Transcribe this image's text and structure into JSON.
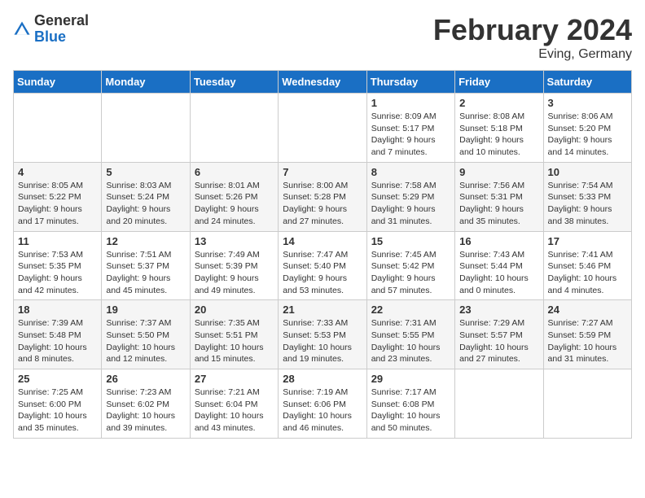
{
  "logo": {
    "general": "General",
    "blue": "Blue"
  },
  "title": "February 2024",
  "subtitle": "Eving, Germany",
  "headers": [
    "Sunday",
    "Monday",
    "Tuesday",
    "Wednesday",
    "Thursday",
    "Friday",
    "Saturday"
  ],
  "weeks": [
    [
      {
        "day": "",
        "info": ""
      },
      {
        "day": "",
        "info": ""
      },
      {
        "day": "",
        "info": ""
      },
      {
        "day": "",
        "info": ""
      },
      {
        "day": "1",
        "info": "Sunrise: 8:09 AM\nSunset: 5:17 PM\nDaylight: 9 hours\nand 7 minutes."
      },
      {
        "day": "2",
        "info": "Sunrise: 8:08 AM\nSunset: 5:18 PM\nDaylight: 9 hours\nand 10 minutes."
      },
      {
        "day": "3",
        "info": "Sunrise: 8:06 AM\nSunset: 5:20 PM\nDaylight: 9 hours\nand 14 minutes."
      }
    ],
    [
      {
        "day": "4",
        "info": "Sunrise: 8:05 AM\nSunset: 5:22 PM\nDaylight: 9 hours\nand 17 minutes."
      },
      {
        "day": "5",
        "info": "Sunrise: 8:03 AM\nSunset: 5:24 PM\nDaylight: 9 hours\nand 20 minutes."
      },
      {
        "day": "6",
        "info": "Sunrise: 8:01 AM\nSunset: 5:26 PM\nDaylight: 9 hours\nand 24 minutes."
      },
      {
        "day": "7",
        "info": "Sunrise: 8:00 AM\nSunset: 5:28 PM\nDaylight: 9 hours\nand 27 minutes."
      },
      {
        "day": "8",
        "info": "Sunrise: 7:58 AM\nSunset: 5:29 PM\nDaylight: 9 hours\nand 31 minutes."
      },
      {
        "day": "9",
        "info": "Sunrise: 7:56 AM\nSunset: 5:31 PM\nDaylight: 9 hours\nand 35 minutes."
      },
      {
        "day": "10",
        "info": "Sunrise: 7:54 AM\nSunset: 5:33 PM\nDaylight: 9 hours\nand 38 minutes."
      }
    ],
    [
      {
        "day": "11",
        "info": "Sunrise: 7:53 AM\nSunset: 5:35 PM\nDaylight: 9 hours\nand 42 minutes."
      },
      {
        "day": "12",
        "info": "Sunrise: 7:51 AM\nSunset: 5:37 PM\nDaylight: 9 hours\nand 45 minutes."
      },
      {
        "day": "13",
        "info": "Sunrise: 7:49 AM\nSunset: 5:39 PM\nDaylight: 9 hours\nand 49 minutes."
      },
      {
        "day": "14",
        "info": "Sunrise: 7:47 AM\nSunset: 5:40 PM\nDaylight: 9 hours\nand 53 minutes."
      },
      {
        "day": "15",
        "info": "Sunrise: 7:45 AM\nSunset: 5:42 PM\nDaylight: 9 hours\nand 57 minutes."
      },
      {
        "day": "16",
        "info": "Sunrise: 7:43 AM\nSunset: 5:44 PM\nDaylight: 10 hours\nand 0 minutes."
      },
      {
        "day": "17",
        "info": "Sunrise: 7:41 AM\nSunset: 5:46 PM\nDaylight: 10 hours\nand 4 minutes."
      }
    ],
    [
      {
        "day": "18",
        "info": "Sunrise: 7:39 AM\nSunset: 5:48 PM\nDaylight: 10 hours\nand 8 minutes."
      },
      {
        "day": "19",
        "info": "Sunrise: 7:37 AM\nSunset: 5:50 PM\nDaylight: 10 hours\nand 12 minutes."
      },
      {
        "day": "20",
        "info": "Sunrise: 7:35 AM\nSunset: 5:51 PM\nDaylight: 10 hours\nand 15 minutes."
      },
      {
        "day": "21",
        "info": "Sunrise: 7:33 AM\nSunset: 5:53 PM\nDaylight: 10 hours\nand 19 minutes."
      },
      {
        "day": "22",
        "info": "Sunrise: 7:31 AM\nSunset: 5:55 PM\nDaylight: 10 hours\nand 23 minutes."
      },
      {
        "day": "23",
        "info": "Sunrise: 7:29 AM\nSunset: 5:57 PM\nDaylight: 10 hours\nand 27 minutes."
      },
      {
        "day": "24",
        "info": "Sunrise: 7:27 AM\nSunset: 5:59 PM\nDaylight: 10 hours\nand 31 minutes."
      }
    ],
    [
      {
        "day": "25",
        "info": "Sunrise: 7:25 AM\nSunset: 6:00 PM\nDaylight: 10 hours\nand 35 minutes."
      },
      {
        "day": "26",
        "info": "Sunrise: 7:23 AM\nSunset: 6:02 PM\nDaylight: 10 hours\nand 39 minutes."
      },
      {
        "day": "27",
        "info": "Sunrise: 7:21 AM\nSunset: 6:04 PM\nDaylight: 10 hours\nand 43 minutes."
      },
      {
        "day": "28",
        "info": "Sunrise: 7:19 AM\nSunset: 6:06 PM\nDaylight: 10 hours\nand 46 minutes."
      },
      {
        "day": "29",
        "info": "Sunrise: 7:17 AM\nSunset: 6:08 PM\nDaylight: 10 hours\nand 50 minutes."
      },
      {
        "day": "",
        "info": ""
      },
      {
        "day": "",
        "info": ""
      }
    ]
  ]
}
